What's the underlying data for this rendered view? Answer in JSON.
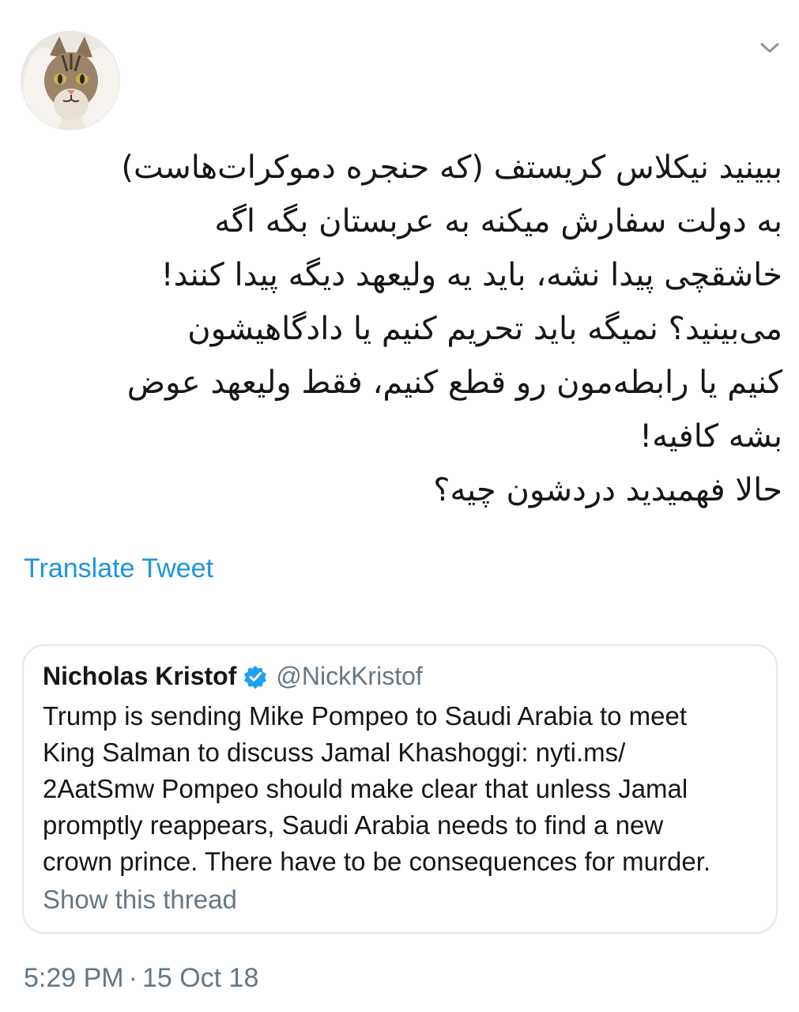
{
  "tweet": {
    "avatar_icon": "cat-avatar-icon",
    "caret_icon": "chevron-down-icon",
    "text_lines": [
      "ببینید نیکلاس کریستف (که حنجره دموکرات‌هاست)",
      "به دولت سفارش میکنه به عربستان بگه اگه",
      "خاشقچی پیدا نشه، باید یه ولیعهد دیگه پیدا کنند!",
      "می‌بینید؟ نمیگه باید تحریم کنیم یا دادگاهیشون",
      "کنیم یا رابطه‌مون رو قطع کنیم، فقط ولیعهد عوض",
      "بشه کافیه!",
      "حالا فهمیدید دردشون چیه؟"
    ],
    "translate_label": "Translate Tweet",
    "time": "5:29 PM",
    "separator": "·",
    "date": "15 Oct 18"
  },
  "quoted": {
    "name": "Nicholas Kristof",
    "verified_icon": "verified-badge-icon",
    "handle": "@NickKristof",
    "text_lines": [
      "Trump is sending Mike Pompeo to Saudi Arabia to meet",
      "King Salman to discuss Jamal Khashoggi: nyti.ms/",
      "2AatSmw Pompeo should make clear that unless Jamal",
      "promptly reappears, Saudi Arabia needs to find a new",
      "crown prince. There have to be consequences for murder."
    ],
    "show_thread_label": "Show this thread"
  },
  "colors": {
    "link_blue": "#1b95e0",
    "secondary_gray": "#657786",
    "border_gray": "#e1e8ed",
    "text_dark": "#14171a"
  }
}
